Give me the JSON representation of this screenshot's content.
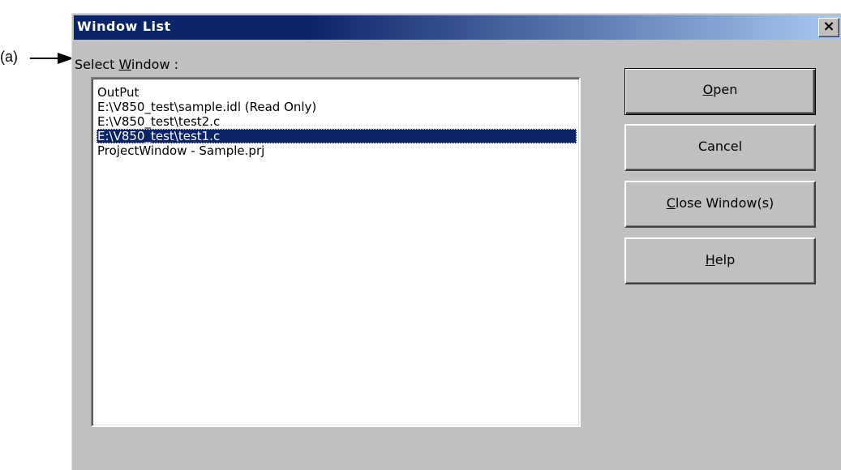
{
  "callout": {
    "label": "(a)"
  },
  "dialog": {
    "title": "Window List",
    "close_glyph": "×",
    "select_label": {
      "pre": "Select ",
      "key": "W",
      "post": "indow :"
    },
    "window_items": [
      {
        "label": "OutPut",
        "selected": false
      },
      {
        "label": "E:\\V850_test\\sample.idl (Read Only)",
        "selected": false
      },
      {
        "label": "E:\\V850_test\\test2.c",
        "selected": false
      },
      {
        "label": "E:\\V850_test\\test1.c",
        "selected": true
      },
      {
        "label": "ProjectWindow - Sample.prj",
        "selected": false
      }
    ],
    "buttons": {
      "open": {
        "key": "O",
        "rest": "pen"
      },
      "cancel": {
        "label": "Cancel"
      },
      "close_windows": {
        "key": "C",
        "rest": "lose Window(s)"
      },
      "help": {
        "key": "H",
        "rest": "elp"
      }
    }
  },
  "colors": {
    "titlebar_start": "#0a246a",
    "titlebar_end": "#a6caf0",
    "dialog_face": "#c0c0c0",
    "selection": "#0a246a"
  }
}
